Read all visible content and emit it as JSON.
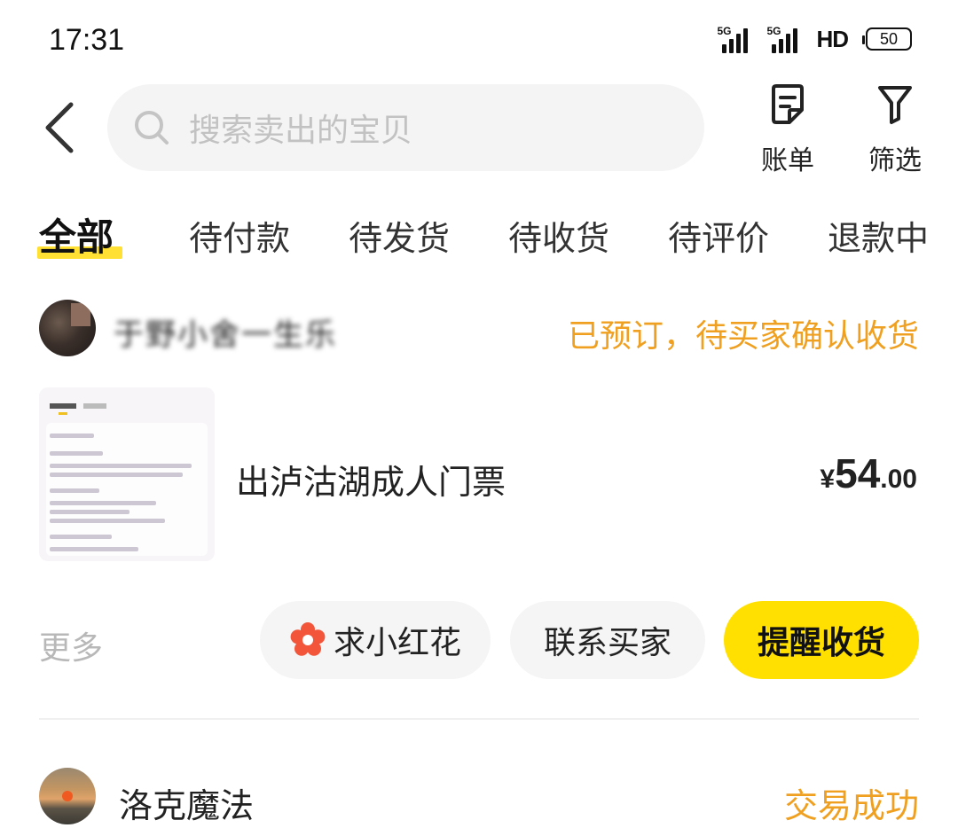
{
  "status_bar": {
    "time": "17:31",
    "signal1_tag": "5G",
    "signal2_tag": "5G",
    "network": "HD",
    "battery": "50"
  },
  "header": {
    "search_placeholder": "搜索卖出的宝贝",
    "bill_label": "账单",
    "filter_label": "筛选"
  },
  "tabs": [
    {
      "label": "全部",
      "active": true
    },
    {
      "label": "待付款",
      "active": false
    },
    {
      "label": "待发货",
      "active": false
    },
    {
      "label": "待收货",
      "active": false
    },
    {
      "label": "待评价",
      "active": false
    },
    {
      "label": "退款中",
      "active": false
    }
  ],
  "orders": [
    {
      "seller_name": "于野小舍一生乐",
      "status": "已预订，待买家确认收货",
      "product_title": "出泸沽湖成人门票",
      "price_currency": "¥",
      "price_int": "54",
      "price_dec": ".00",
      "more_label": "更多",
      "actions": {
        "flower": "求小红花",
        "contact": "联系买家",
        "remind": "提醒收货"
      }
    },
    {
      "seller_name": "洛克魔法",
      "status": "交易成功"
    }
  ],
  "colors": {
    "accent_yellow": "#ffe000",
    "status_orange": "#f0a020",
    "flower_red": "#f2553a"
  }
}
